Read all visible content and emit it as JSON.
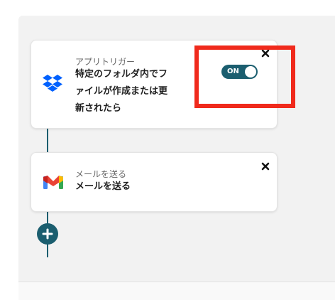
{
  "trigger_card": {
    "subtitle": "アプリトリガー",
    "title_lines": [
      "特定のフォルダ内でフ",
      "ァイルが作成または更",
      "新されたら"
    ],
    "toggle_label": "ON",
    "app_icon": "dropbox-icon",
    "close_icon": "close-icon"
  },
  "action_card": {
    "subtitle": "メールを送る",
    "title": "メールを送る",
    "app_icon": "gmail-icon",
    "close_icon": "close-icon"
  },
  "add_button": {
    "icon": "plus-icon"
  },
  "colors": {
    "accent": "#1b5e6f",
    "highlight": "#f02a1c",
    "canvas_bg": "#f2f2f2"
  }
}
